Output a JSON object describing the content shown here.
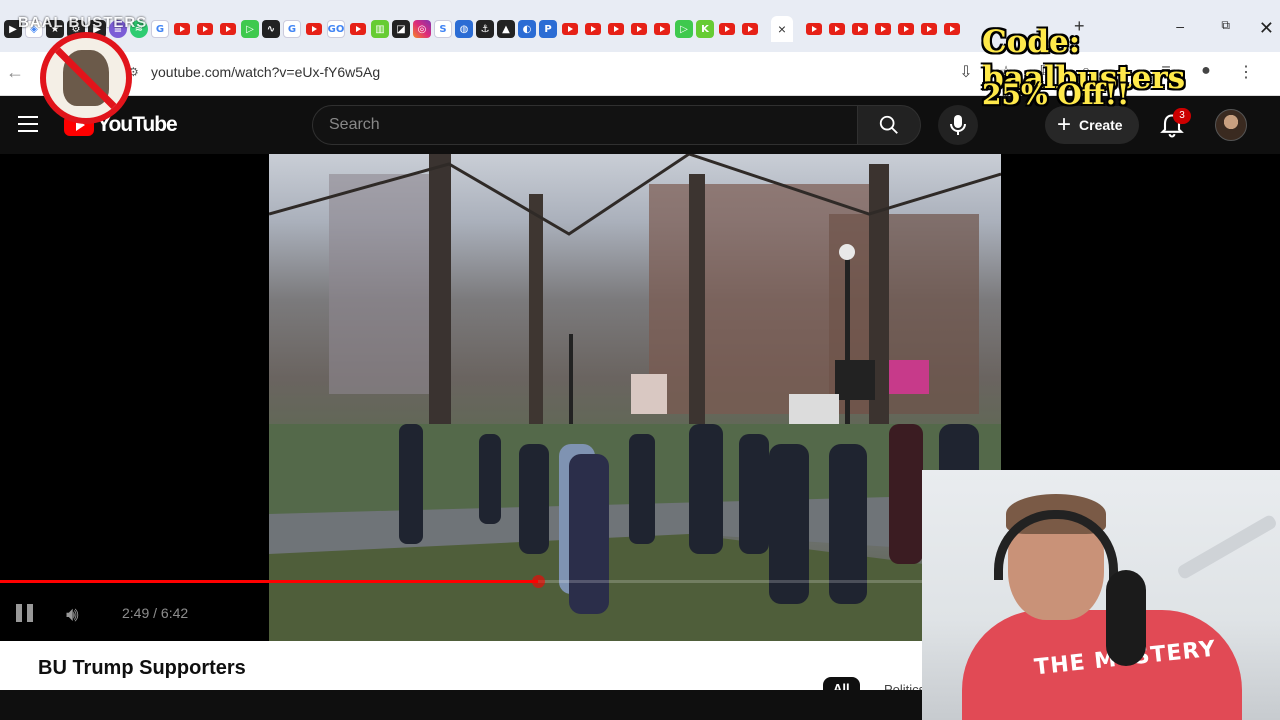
{
  "browser": {
    "url": "youtube.com/watch?v=eUx-fY6w5Ag",
    "active_tab_close": "×",
    "new_tab": "+",
    "window_controls": {
      "minimize": "–",
      "maximize": "⧉",
      "close": "✕"
    }
  },
  "overlay": {
    "logo_text": "BAAL BUSTERS",
    "promo_code": "Code: baalbusters",
    "promo_discount": "25% Off!!"
  },
  "youtube": {
    "logo_word": "YouTube",
    "search_placeholder": "Search",
    "create_label": "Create",
    "notification_count": "3"
  },
  "player": {
    "time_display": "2:49 / 6:42",
    "progress": 0.42
  },
  "video": {
    "title": "BU Trump Supporters"
  },
  "chips": {
    "all": "All",
    "politics": "Politics Ne"
  },
  "webcam": {
    "shirt_text": "THE MYSTERY"
  },
  "colors": {
    "brand_red": "#ff0000",
    "promo_yellow": "#ffe94a",
    "header_bg": "#0f0f0f"
  }
}
